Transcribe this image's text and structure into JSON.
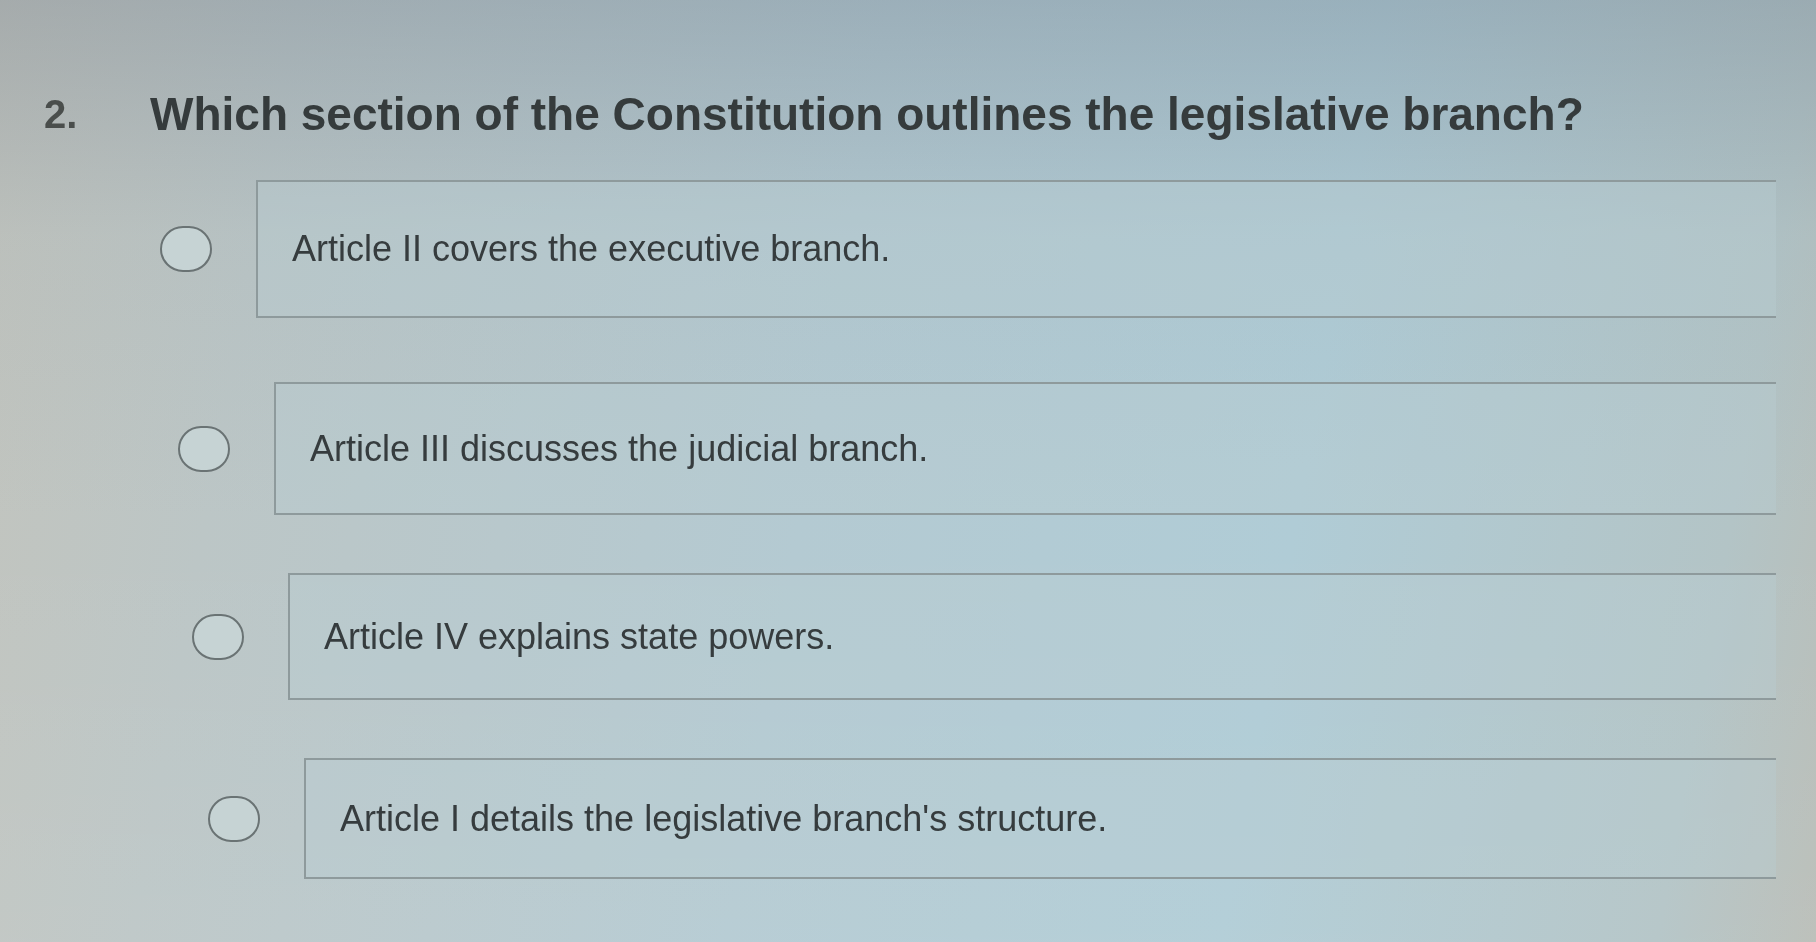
{
  "question": {
    "number": "2.",
    "text": "Which section of the Constitution outlines the legislative branch?"
  },
  "options": [
    {
      "text": "Article II covers the executive branch.",
      "selected": false
    },
    {
      "text": "Article III discusses the judicial branch.",
      "selected": false
    },
    {
      "text": "Article IV explains state powers.",
      "selected": false
    },
    {
      "text": "Article I details the legislative branch's structure.",
      "selected": false
    }
  ]
}
